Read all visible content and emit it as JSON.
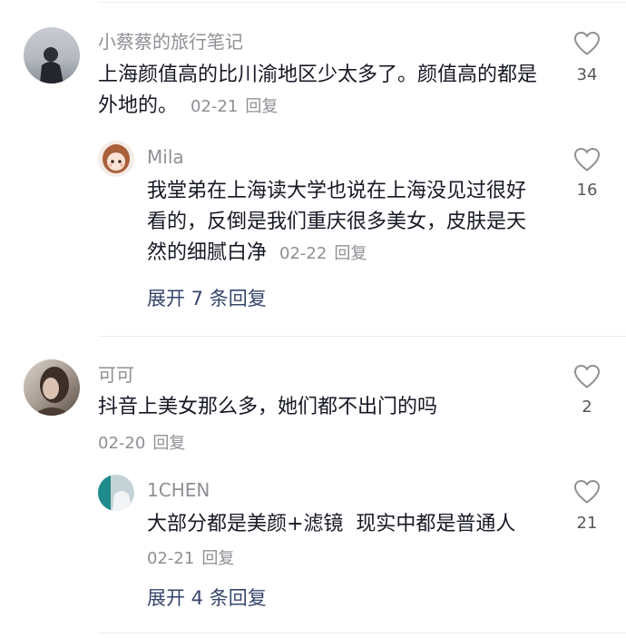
{
  "comments": [
    {
      "author": "小蔡蔡的旅行笔记",
      "text": "上海颜值高的比川渝地区少太多了。颜值高的都是外地的。",
      "date": "02-21",
      "reply_label": "回复",
      "likes": "34",
      "replies": [
        {
          "author": "Mila",
          "text": "我堂弟在上海读大学也说在上海没见过很好看的，反倒是我们重庆很多美女，皮肤是天然的细腻白净",
          "date": "02-22",
          "reply_label": "回复",
          "likes": "16"
        }
      ],
      "expand_label": "展开 7 条回复"
    },
    {
      "author": "可可",
      "text": "抖音上美女那么多，她们都不出门的吗",
      "date": "02-20",
      "reply_label": "回复",
      "likes": "2",
      "replies": [
        {
          "author": "1CHEN",
          "text": "大部分都是美颜+滤镜  现实中都是普通人",
          "date": "02-21",
          "reply_label": "回复",
          "likes": "21"
        }
      ],
      "expand_label": "展开 4 条回复"
    }
  ],
  "icons": {
    "like": "heart-outline-icon"
  }
}
